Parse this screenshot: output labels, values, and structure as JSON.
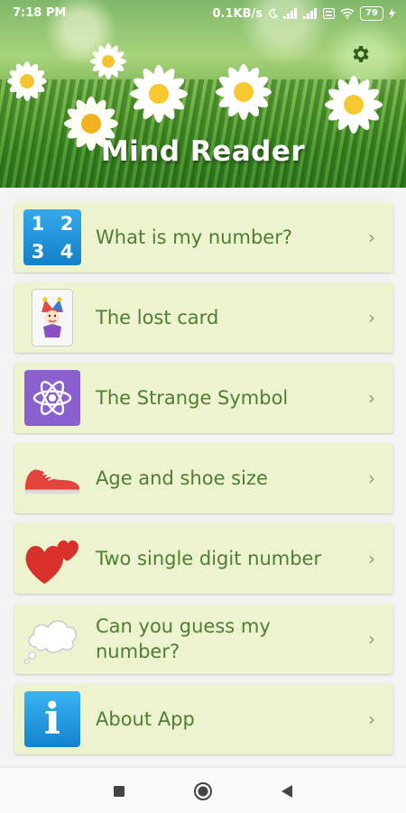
{
  "status_bar": {
    "time": "7:18 PM",
    "net_speed": "0.1KB/s",
    "battery": "79"
  },
  "header": {
    "title": "Mind Reader",
    "settings_icon": "gear-icon"
  },
  "menu": {
    "items": [
      {
        "label": "What is my number?",
        "icon": "number-grid-icon",
        "digits": [
          "1",
          "2",
          "3",
          "4"
        ]
      },
      {
        "label": "The lost card",
        "icon": "joker-card-icon"
      },
      {
        "label": "The Strange Symbol",
        "icon": "atom-icon"
      },
      {
        "label": "Age and shoe size",
        "icon": "sneaker-icon"
      },
      {
        "label": "Two single digit number",
        "icon": "hearts-icon"
      },
      {
        "label": "Can you guess my number?",
        "icon": "thought-bubble-icon"
      },
      {
        "label": "About App",
        "icon": "info-icon",
        "glyph": "i"
      }
    ],
    "chevron": "›"
  },
  "nav_bar": {
    "buttons": [
      "recents-button",
      "home-button",
      "back-button"
    ]
  },
  "colors": {
    "item_background": "#eef3cf",
    "item_text": "#4e7d33",
    "header_green": "#3f8a2b"
  }
}
